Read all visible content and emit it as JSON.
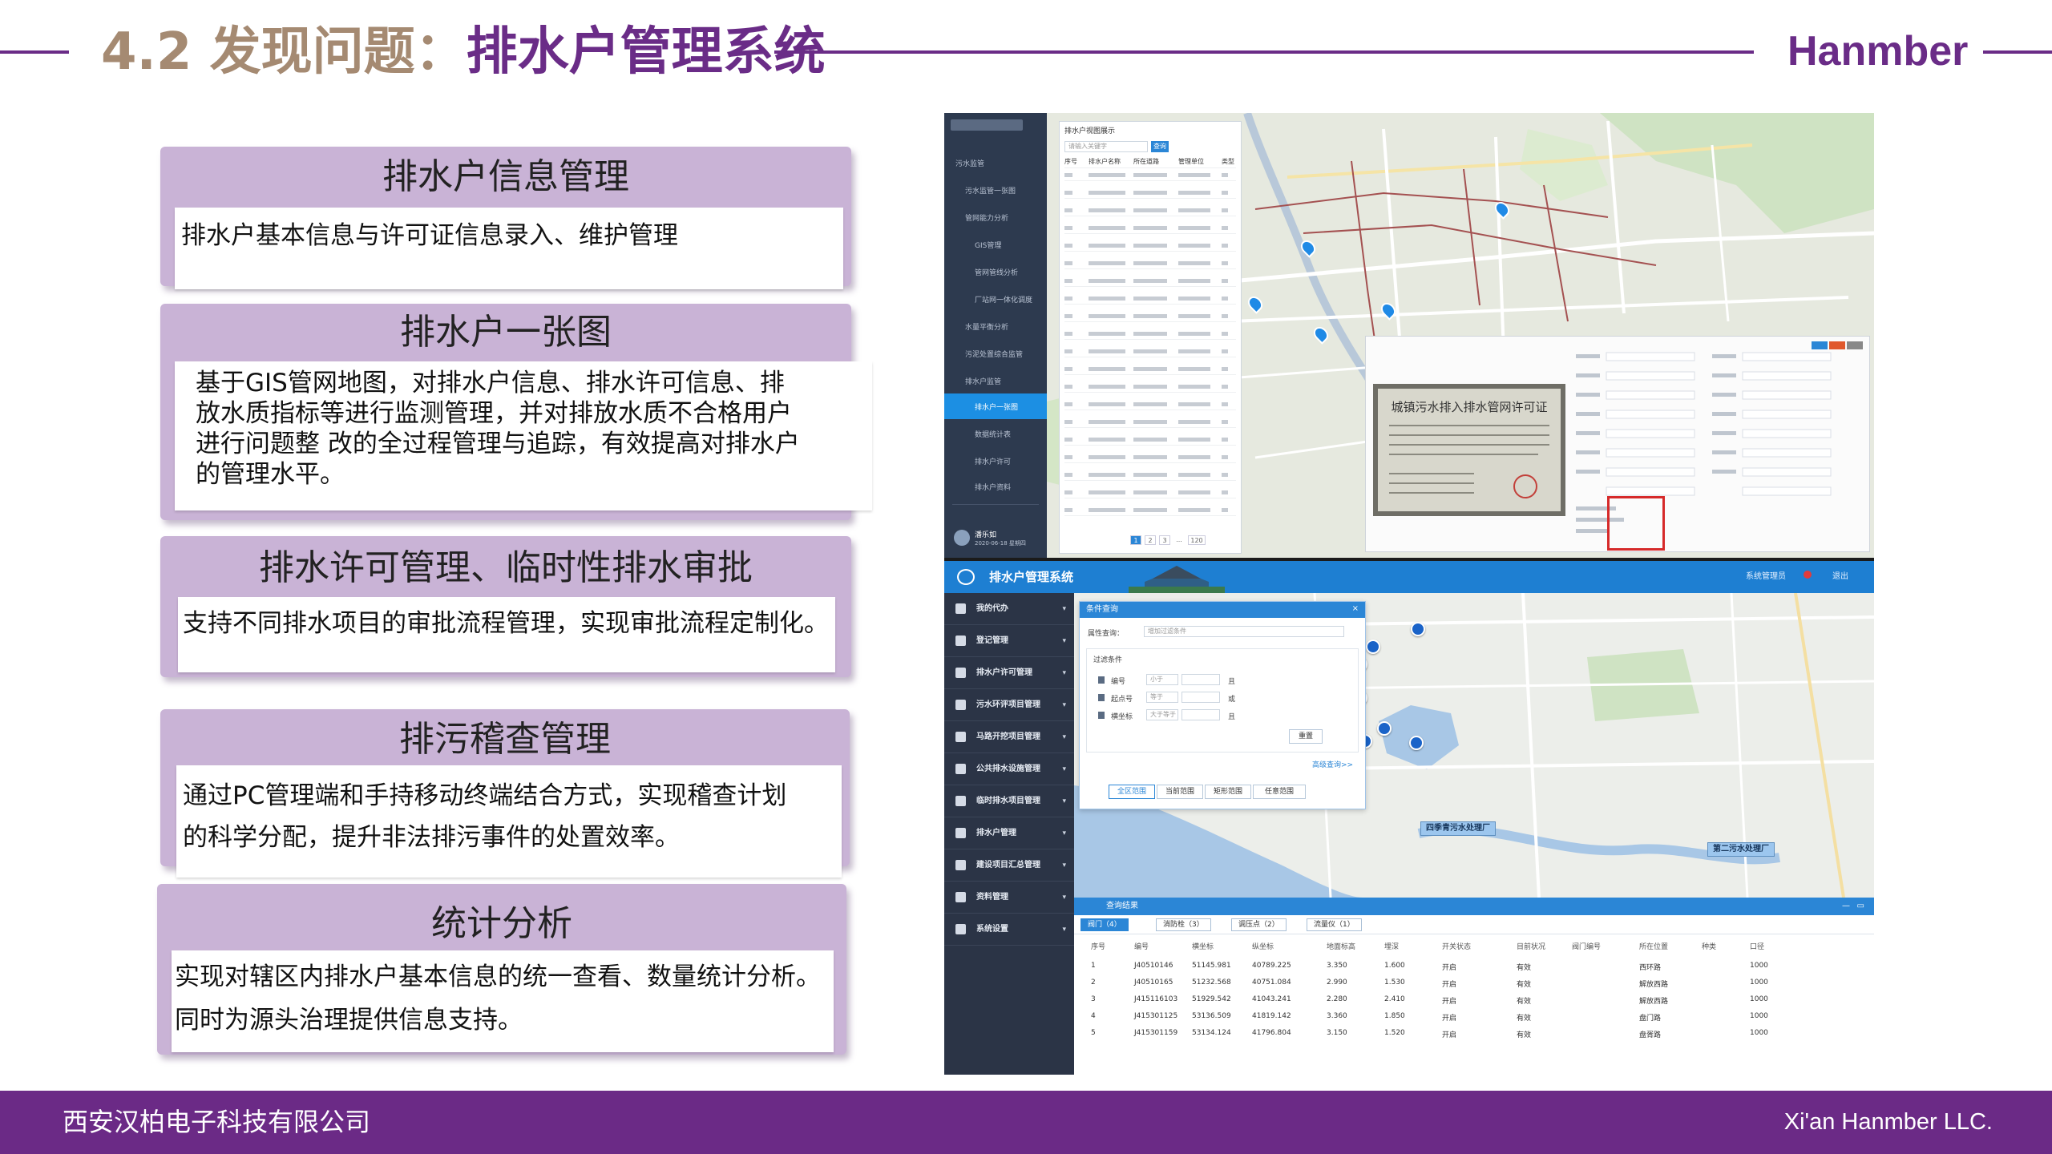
{
  "header": {
    "section_number": "4.2 发现问题：",
    "section_title": "排水户管理系统",
    "brand": "Hanmber"
  },
  "features": [
    {
      "title": "排水户信息管理",
      "lines": [
        "排水户基本信息与许可证信息录入、维护管理"
      ]
    },
    {
      "title": "排水户一张图",
      "lines": [
        "基于GIS管网地图，对排水户信息、排水许可信息、排",
        "放水质指标等进行监测管理，并对排放水质不合格用户",
        "进行问题整 改的全过程管理与追踪，有效提高对排水户",
        "的管理水平。"
      ]
    },
    {
      "title": "排水许可管理、临时性排水审批",
      "lines": [
        "支持不同排水项目的审批流程管理，实现审批流程定制化。"
      ]
    },
    {
      "title": "排污稽查管理",
      "lines": [
        "通过PC管理端和手持移动终端结合方式，实现稽查计划",
        "的科学分配，提升非法排污事件的处置效率。"
      ]
    },
    {
      "title": "统计分析",
      "lines": [
        "实现对辖区内排水户基本信息的统一查看、数量统计分析。",
        "同时为源头治理提供信息支持。"
      ]
    }
  ],
  "screenshot": {
    "top": {
      "sidebar_items": [
        "污水监管",
        "污水监管一张图",
        "管网能力分析",
        "GIS管理",
        "管网管线分析",
        "厂站网一体化调度",
        "水量平衡分析",
        "污泥处置综合监管",
        "排水户监管",
        "排水户一张图",
        "数据统计表",
        "排水户许可",
        "排水户资料"
      ],
      "active_item_index": 9,
      "list_title": "排水户视图展示",
      "search_placeholder": "请输入关键字",
      "search_button": "查询",
      "table_headers": [
        "序号",
        "排水户名称",
        "所在道路",
        "管理单位",
        "类型"
      ],
      "row_count": 20,
      "pager": [
        "1",
        "2",
        "3",
        "...",
        "120"
      ],
      "certificate_title": "城镇污水排入排水管网许可证",
      "user_name": "潘乐如",
      "user_date": "2020-06-18 星期四"
    },
    "system_title": "排水户管理系统",
    "topbar_right": [
      "系统管理员",
      "退出"
    ],
    "sidebar": [
      "我的代办",
      "登记管理",
      "排水户许可管理",
      "污水环评项目管理",
      "马路开挖项目管理",
      "公共排水设施管理",
      "临时排水项目管理",
      "排水户管理",
      "建设项目汇总管理",
      "资料管理",
      "系统设置"
    ],
    "query_panel": {
      "title": "条件查询",
      "property_label": "属性查询：",
      "property_placeholder": "增加过滤条件",
      "filter_title": "过滤条件",
      "filters": [
        {
          "field": "编号",
          "op": "小于",
          "logic": "且"
        },
        {
          "field": "起点号",
          "op": "等于",
          "logic": "或"
        },
        {
          "field": "横坐标",
          "op": "大于等于",
          "logic": "且"
        }
      ],
      "reset": "重置",
      "advanced": "高级查询>>",
      "scope_buttons": [
        "全区范围",
        "当前范围",
        "矩形范围",
        "任意范围"
      ]
    },
    "plant_labels": [
      "四季青污水处理厂",
      "第二污水处理厂"
    ],
    "results": {
      "title": "查询结果",
      "tabs": [
        "阀门（4）",
        "消防栓（3）",
        "调压点（2）",
        "流量仪（1）"
      ],
      "columns": [
        "序号",
        "编号",
        "横坐标",
        "纵坐标",
        "地面标高",
        "埋深",
        "开关状态",
        "目前状况",
        "阀门编号",
        "所在位置",
        "种类",
        "口径"
      ],
      "rows": [
        [
          "1",
          "J40510146",
          "51145.981",
          "40789.225",
          "3.350",
          "1.600",
          "开启",
          "有效",
          "",
          "西环路",
          "",
          "1000"
        ],
        [
          "2",
          "J40510165",
          "51232.568",
          "40751.084",
          "2.990",
          "1.530",
          "开启",
          "有效",
          "",
          "解放西路",
          "",
          "1000"
        ],
        [
          "3",
          "J415116103",
          "51929.542",
          "41043.241",
          "2.280",
          "2.410",
          "开启",
          "有效",
          "",
          "解放西路",
          "",
          "1000"
        ],
        [
          "4",
          "J415301125",
          "53136.509",
          "41819.142",
          "3.360",
          "1.850",
          "开启",
          "有效",
          "",
          "盘门路",
          "",
          "1000"
        ],
        [
          "5",
          "J415301159",
          "53134.124",
          "41796.804",
          "3.150",
          "1.520",
          "开启",
          "有效",
          "",
          "盘胥路",
          "",
          "1000"
        ]
      ]
    }
  },
  "footer": {
    "company_cn": "西安汉柏电子科技有限公司",
    "company_en": "Xi'an Hanmber LLC."
  },
  "colors": {
    "brand_purple": "#6a2c87",
    "title_tan": "#a58a72",
    "card_bg": "#c9b3d6",
    "app_blue": "#1e7fd2",
    "sidebar_dark": "#2b3446"
  }
}
